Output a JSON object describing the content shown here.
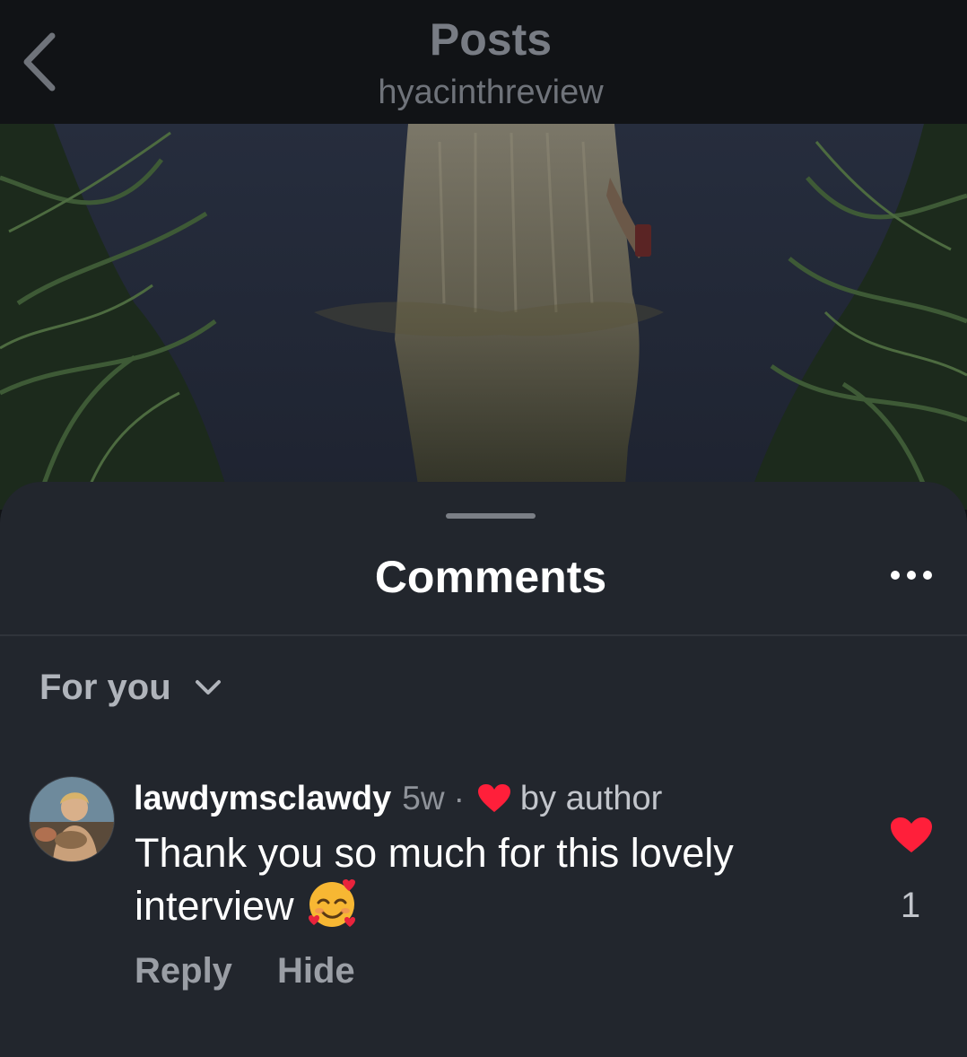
{
  "header": {
    "title": "Posts",
    "subtitle": "hyacinthreview",
    "back_icon": "chevron-left-icon"
  },
  "post": {
    "image_alt": "dimmed post photo"
  },
  "comments_sheet": {
    "title": "Comments",
    "more_icon": "more-horizontal-icon",
    "sort": {
      "selected": "For you",
      "icon": "chevron-down-icon"
    },
    "comments": [
      {
        "username": "lawdymsclawdy",
        "time_ago": "5w",
        "separator": "·",
        "author_liked_label": "by author",
        "author_liked_icon": "heart-icon",
        "text": "Thank you so much for this lovely interview",
        "emoji_icon": "smiling-face-with-hearts-emoji",
        "actions": {
          "reply": "Reply",
          "hide": "Hide"
        },
        "like_count": "1",
        "liked": true
      }
    ]
  },
  "colors": {
    "background": "#111316",
    "sheet": "#22262d",
    "heart": "#ff1f3a",
    "muted_text": "#8f939a"
  }
}
